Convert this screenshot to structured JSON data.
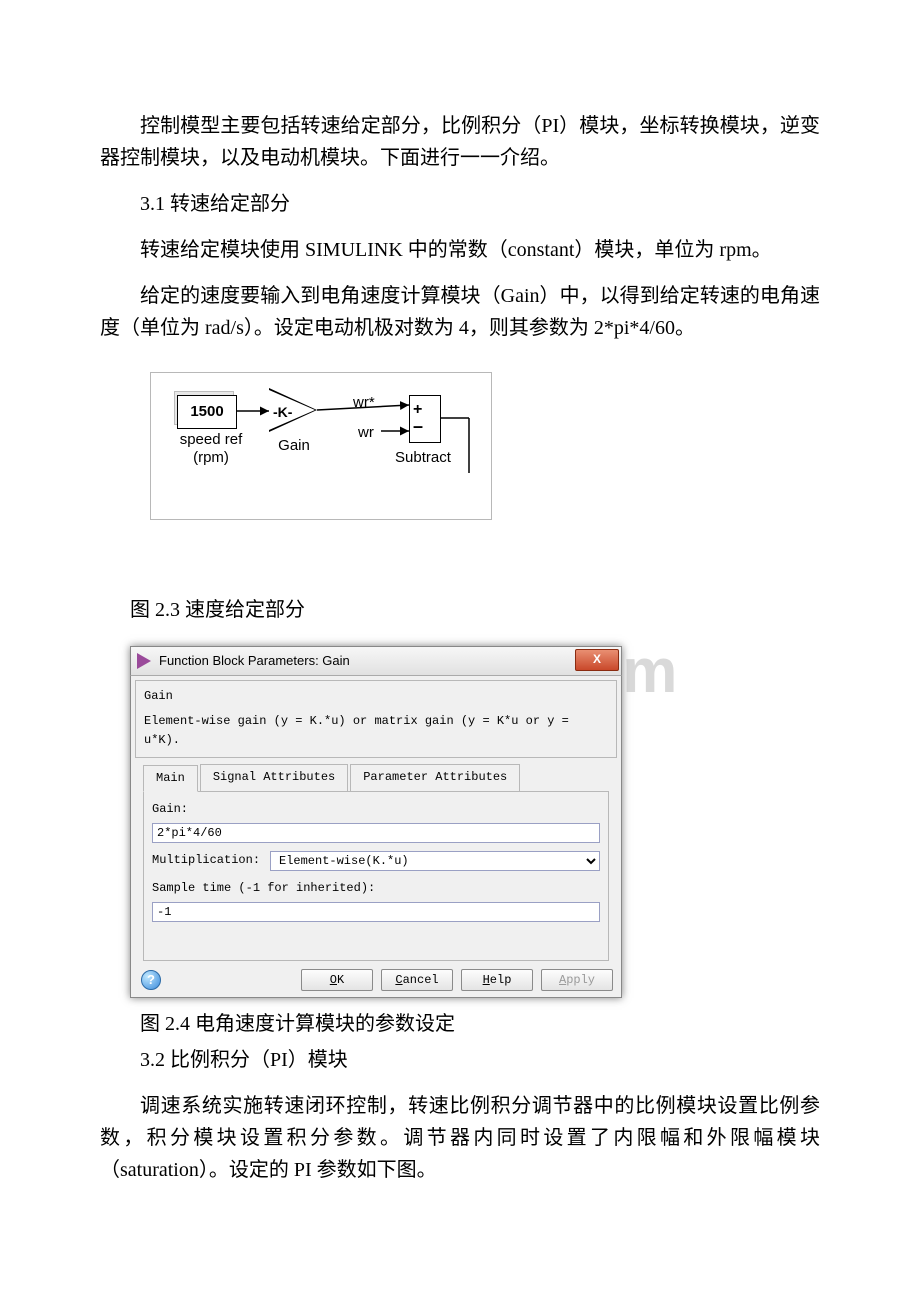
{
  "paragraphs": {
    "p1": "控制模型主要包括转速给定部分，比例积分（PI）模块，坐标转换模块，逆变器控制模块，以及电动机模块。下面进行一一介绍。",
    "p2": "3.1 转速给定部分",
    "p3": "转速给定模块使用 SIMULINK 中的常数（constant）模块，单位为 rpm。",
    "p4": "给定的速度要输入到电角速度计算模块（Gain）中，以得到给定转速的电角速度（单位为 rad/s）。设定电动机极对数为 4，则其参数为 2*pi*4/60。",
    "p5": "3.2 比例积分（PI）模块",
    "p6": "调速系统实施转速闭环控制，转速比例积分调节器中的比例模块设置比例参数，积分模块设置积分参数。调节器内同时设置了内限幅和外限幅模块（saturation）。设定的 PI 参数如下图。"
  },
  "captions": {
    "fig23": "图 2.3 速度给定部分",
    "fig24": "图 2.4 电角速度计算模块的参数设定"
  },
  "simulink": {
    "const_value": "1500",
    "const_label_line1": "speed ref",
    "const_label_line2": "(rpm)",
    "gain_text": "-K-",
    "gain_label": "Gain",
    "wr_star": "wr*",
    "wr": "wr",
    "sum_plus": "+",
    "sum_minus": "–",
    "sum_label": "Subtract"
  },
  "dialog": {
    "title": "Function Block Parameters: Gain",
    "group_title": "Gain",
    "group_desc": "Element-wise gain (y = K.*u) or matrix gain (y = K*u or y = u*K).",
    "tabs": {
      "main": "Main",
      "signal": "Signal Attributes",
      "param": "Parameter Attributes"
    },
    "fields": {
      "gain_label": "Gain:",
      "gain_value": "2*pi*4/60",
      "mult_label": "Multiplication:",
      "mult_value": "Element-wise(K.*u)",
      "sample_label": "Sample time (-1 for inherited):",
      "sample_value": "-1"
    },
    "buttons": {
      "ok": "OK",
      "ok_u": "O",
      "cancel": "Cancel",
      "cancel_u": "C",
      "help": "Help",
      "help_u": "H",
      "apply": "Apply",
      "apply_u": "A",
      "qmark": "?"
    },
    "close_x": "X"
  },
  "watermark": "docx.com"
}
